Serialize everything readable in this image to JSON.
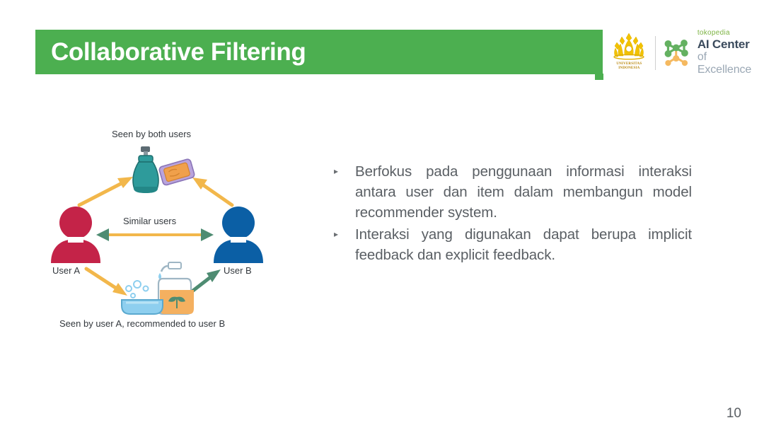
{
  "slide": {
    "title": "Collaborative Filtering",
    "page_number": "10",
    "accent_green": "#4CAF50",
    "text_color": "#5a5f64"
  },
  "logos": {
    "university": {
      "name": "universitas-indonesia-makara-logo",
      "line1": "UNIVERSITAS",
      "line2": "INDONESIA",
      "color": "#F2C200"
    },
    "ai_center": {
      "name": "tokopedia-ai-center-of-excellence-logo",
      "brand": "tokopedia",
      "line1": "AI Center",
      "line2": "of Excellence",
      "brand_color": "#7CB342",
      "node_green": "#64B161",
      "node_orange": "#F5B960"
    }
  },
  "diagram": {
    "name": "collaborative-filtering-diagram",
    "labels": {
      "top_caption": "Seen by both users",
      "middle_caption": "Similar users",
      "user_a": "User A",
      "user_b": "User B",
      "bottom_caption": "Seen by user A, recommended to user B"
    },
    "colors": {
      "user_a": "#C42348",
      "user_b": "#0B5FA5",
      "arrow_yellow": "#F2B74B",
      "arrow_green": "#4E8C72",
      "spray_bottle": "#2E9B9B",
      "soap_bar_wrap": "#B9A3DC",
      "soap_bar_label": "#F0A04B",
      "dispenser_label": "#F4B060",
      "basin": "#8ECFEF"
    },
    "items": [
      {
        "name": "spray-bottle-icon",
        "caption": "Seen by both users"
      },
      {
        "name": "soap-bar-icon",
        "caption": "Seen by both users"
      },
      {
        "name": "soap-dispenser-icon",
        "caption": "Seen by user A, recommended to user B"
      },
      {
        "name": "wash-basin-icon",
        "caption": "Seen by user A, recommended to user B"
      }
    ]
  },
  "content": {
    "bullets": [
      {
        "marker": "▸",
        "text": "Berfokus pada penggunaan informasi interaksi antara user dan item dalam membangun model recommender system."
      },
      {
        "marker": "▸",
        "text": "Interaksi yang digunakan dapat berupa implicit feedback dan explicit feedback."
      }
    ]
  }
}
